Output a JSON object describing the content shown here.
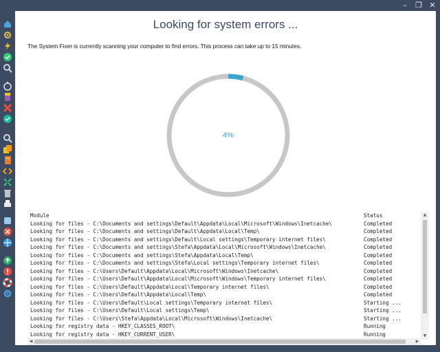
{
  "window": {
    "minimize": "–",
    "restore": "❐",
    "close": "✕"
  },
  "sidebar": {
    "icons": [
      {
        "name": "home-icon",
        "color": "#4aa3df"
      },
      {
        "name": "gear-icon",
        "color": "#e5c24a"
      },
      {
        "name": "lightning-icon",
        "color": "#f0c419"
      },
      {
        "name": "check-shield-icon",
        "color": "#2ecc71"
      },
      {
        "name": "magnifier-icon",
        "color": "#cfd6e0"
      },
      {
        "name": "stopwatch-icon",
        "color": "#e8e8e8"
      },
      {
        "name": "paint-icon",
        "color": "#9b59b6"
      },
      {
        "name": "cross-tools-icon",
        "color": "#e74c3c"
      },
      {
        "name": "refresh-icon",
        "color": "#1abc9c"
      },
      {
        "name": "zoom-icon",
        "color": "#cfd6e0"
      },
      {
        "name": "copy-icon",
        "color": "#f1c40f"
      },
      {
        "name": "document-icon",
        "color": "#e67e22"
      },
      {
        "name": "code-icon",
        "color": "#f39c12"
      },
      {
        "name": "resize-icon",
        "color": "#2ecc71"
      },
      {
        "name": "trash-icon",
        "color": "#bdc3c7"
      },
      {
        "name": "printer-icon",
        "color": "#e8e8e8"
      },
      {
        "name": "puzzle-icon",
        "color": "#9ac8f0"
      },
      {
        "name": "error-icon",
        "color": "#e74c3c"
      },
      {
        "name": "globe-icon",
        "color": "#3498db"
      },
      {
        "name": "upload-icon",
        "color": "#27ae60"
      },
      {
        "name": "alert-icon",
        "color": "#e74c3c"
      },
      {
        "name": "lifebuoy-icon",
        "color": "#f5f5f5"
      },
      {
        "name": "settings-icon",
        "color": "#4aa3df"
      }
    ]
  },
  "main": {
    "title": "Looking for system errors ...",
    "description": "The System Fixer is currently scanning your computer to find errors. This process can take up to 15 minutes.",
    "progress": {
      "percent_label": "4%",
      "fraction": 0.04,
      "track_color": "#c7c7c7",
      "fill_color": "#3ea3cd"
    }
  },
  "log": {
    "columns": {
      "module": "Module",
      "status": "Status"
    },
    "rows": [
      {
        "module": "Looking for files - C:\\Documents and settings\\Default\\Appdata\\Local\\Microsoft\\Windows\\Inetcache\\",
        "status": "Completed"
      },
      {
        "module": "Looking for files - C:\\Documents and settings\\Default\\Appdata\\Local\\Temp\\",
        "status": "Completed"
      },
      {
        "module": "Looking for files - C:\\Documents and settings\\Default\\Local settings\\Temporary internet files\\",
        "status": "Completed"
      },
      {
        "module": "Looking for files - C:\\Documents and settings\\Stefa\\Appdata\\Local\\Microsoft\\Windows\\Inetcache\\",
        "status": "Completed"
      },
      {
        "module": "Looking for files - C:\\Documents and settings\\Stefa\\Appdata\\Local\\Temp\\",
        "status": "Completed"
      },
      {
        "module": "Looking for files - C:\\Documents and settings\\Stefa\\Local settings\\Temporary internet files\\",
        "status": "Completed"
      },
      {
        "module": "Looking for files - C:\\Users\\Default\\Appdata\\Local\\Microsoft\\Windows\\Inetcache\\",
        "status": "Completed"
      },
      {
        "module": "Looking for files - C:\\Users\\Default\\Appdata\\Local\\Microsoft\\Windows\\Temporary internet files\\",
        "status": "Completed"
      },
      {
        "module": "Looking for files - C:\\Users\\Default\\Appdata\\Local\\Temporary internet files\\",
        "status": "Completed"
      },
      {
        "module": "Looking for files - C:\\Users\\Default\\Appdata\\Local\\Temp\\",
        "status": "Completed"
      },
      {
        "module": "Looking for files - C:\\Users\\Default\\Local settings\\Temporary internet files\\",
        "status": "Starting ..."
      },
      {
        "module": "Looking for files - C:\\Users\\Default\\Local settings\\Temp\\",
        "status": "Starting ..."
      },
      {
        "module": "Looking for files - C:\\Users\\Stefa\\Appdata\\Local\\Microsoft\\Windows\\Inetcache\\",
        "status": "Starting ..."
      },
      {
        "module": "Looking for registry data - HKEY_CLASSES_ROOT\\",
        "status": "Running"
      },
      {
        "module": "Looking for registry data - HKEY_CURRENT_USER\\",
        "status": "Running"
      }
    ]
  }
}
